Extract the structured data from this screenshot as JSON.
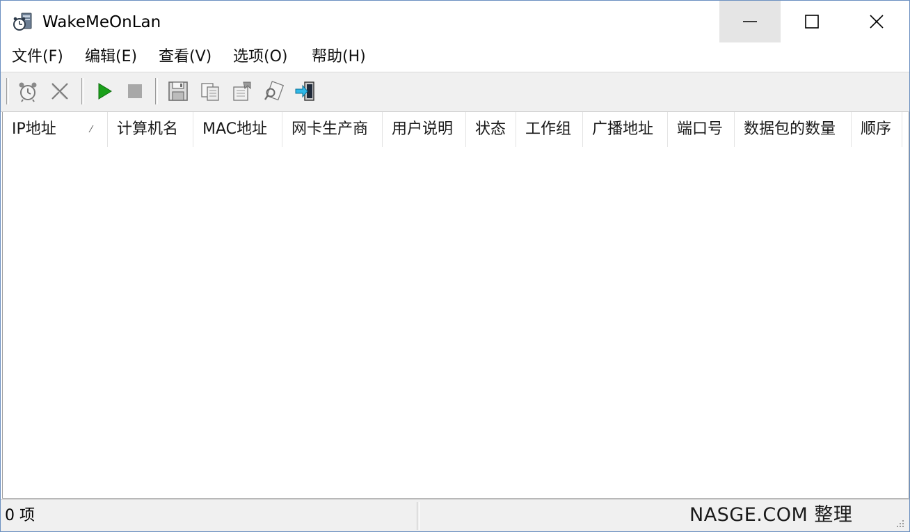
{
  "window": {
    "title": "WakeMeOnLan"
  },
  "menu": [
    {
      "label": "文件(F)"
    },
    {
      "label": "编辑(E)"
    },
    {
      "label": "查看(V)"
    },
    {
      "label": "选项(O)"
    },
    {
      "label": "帮助(H)"
    }
  ],
  "toolbar": {
    "buttons": [
      {
        "icon": "alarm-clock-icon"
      },
      {
        "icon": "delete-x-icon"
      },
      {
        "icon": "play-icon"
      },
      {
        "icon": "stop-icon"
      },
      {
        "icon": "save-icon"
      },
      {
        "icon": "copy-icon"
      },
      {
        "icon": "properties-icon"
      },
      {
        "icon": "find-icon"
      },
      {
        "icon": "exit-icon"
      }
    ]
  },
  "columns": [
    {
      "label": "IP地址",
      "sort": "⁄"
    },
    {
      "label": "计算机名"
    },
    {
      "label": "MAC地址"
    },
    {
      "label": "网卡生产商"
    },
    {
      "label": "用户说明"
    },
    {
      "label": "状态"
    },
    {
      "label": "工作组"
    },
    {
      "label": "广播地址"
    },
    {
      "label": "端口号"
    },
    {
      "label": "数据包的数量"
    },
    {
      "label": "顺序"
    }
  ],
  "status": {
    "count": "0 项",
    "watermark": "NASGE.COM 整理"
  },
  "colors": {
    "play": "#1aa01a",
    "accent": "#0078d7"
  }
}
